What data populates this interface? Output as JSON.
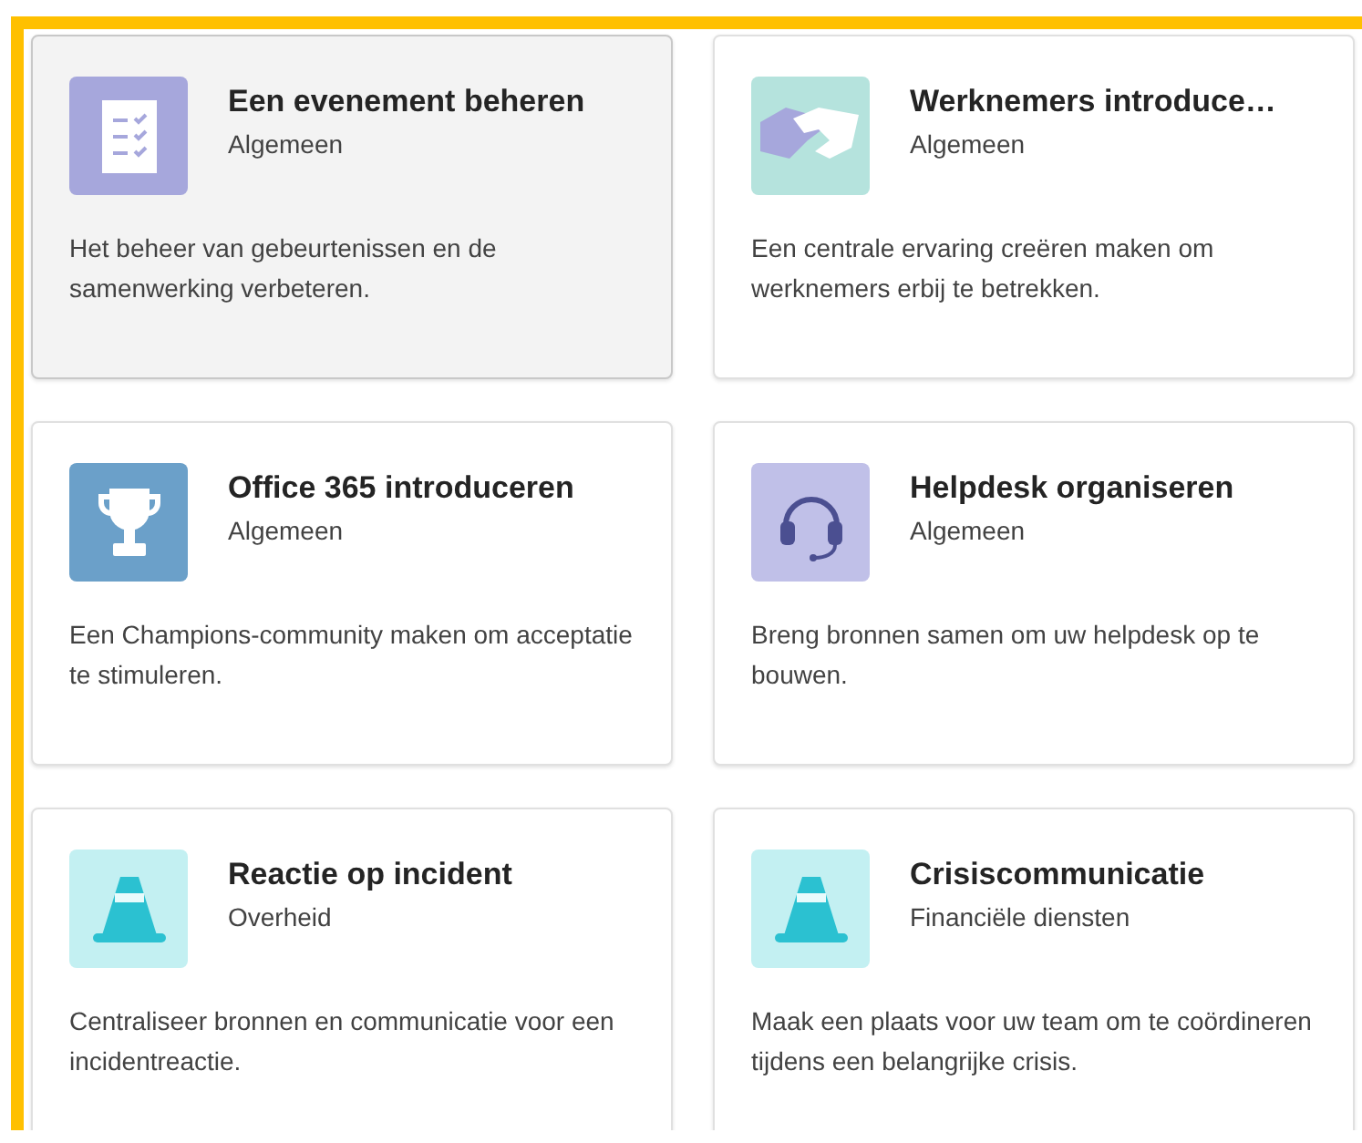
{
  "cards": [
    {
      "kind": "checklist",
      "title": "Een evenement beheren",
      "category": "Algemeen",
      "description": "Het beheer van gebeurtenissen en de samenwerking verbeteren.",
      "selected": true
    },
    {
      "kind": "handshake",
      "title": "Werknemers introduce…",
      "category": "Algemeen",
      "description": "Een centrale ervaring creëren maken om werknemers erbij te betrekken.",
      "selected": false
    },
    {
      "kind": "trophy",
      "title": "Office 365 introduceren",
      "category": "Algemeen",
      "description": "Een Champions-community maken om acceptatie te stimuleren.",
      "selected": false
    },
    {
      "kind": "headset",
      "title": "Helpdesk organiseren",
      "category": "Algemeen",
      "description": "Breng bronnen samen om uw helpdesk op te bouwen.",
      "selected": false
    },
    {
      "kind": "cone",
      "title": "Reactie op incident",
      "category": "Overheid",
      "description": "Centraliseer bronnen en communicatie voor een incidentreactie.",
      "selected": false
    },
    {
      "kind": "cone",
      "title": "Crisiscommunicatie",
      "category": "Financiële diensten",
      "description": "Maak een plaats voor uw team om te coördineren tijdens een belangrijke crisis.",
      "selected": false
    }
  ]
}
